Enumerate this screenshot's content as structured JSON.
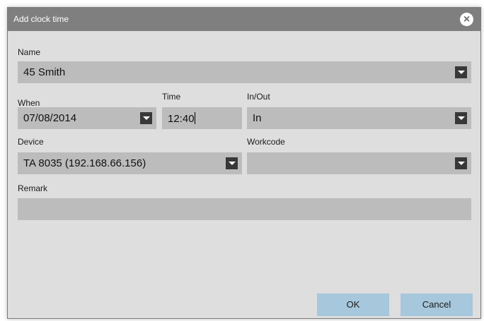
{
  "dialog": {
    "title": "Add clock time",
    "close_icon": "close-icon"
  },
  "form": {
    "name": {
      "label": "Name",
      "value": "45 Smith"
    },
    "when": {
      "label": "When",
      "value": "07/08/2014"
    },
    "time": {
      "label": "Time",
      "value": "12:40"
    },
    "inout": {
      "label": "In/Out",
      "value": "In"
    },
    "device": {
      "label": "Device",
      "value": "TA 8035 (192.168.66.156)"
    },
    "workcode": {
      "label": "Workcode",
      "value": ""
    },
    "remark": {
      "label": "Remark",
      "value": ""
    }
  },
  "buttons": {
    "ok_label": "OK",
    "cancel_label": "Cancel"
  },
  "colors": {
    "titlebar": "#7f7f7f",
    "dialog_bg": "#dedede",
    "field_bg": "#bcbcbc",
    "dropdown_button": "#383838",
    "button_bg": "#a6c7dc"
  }
}
